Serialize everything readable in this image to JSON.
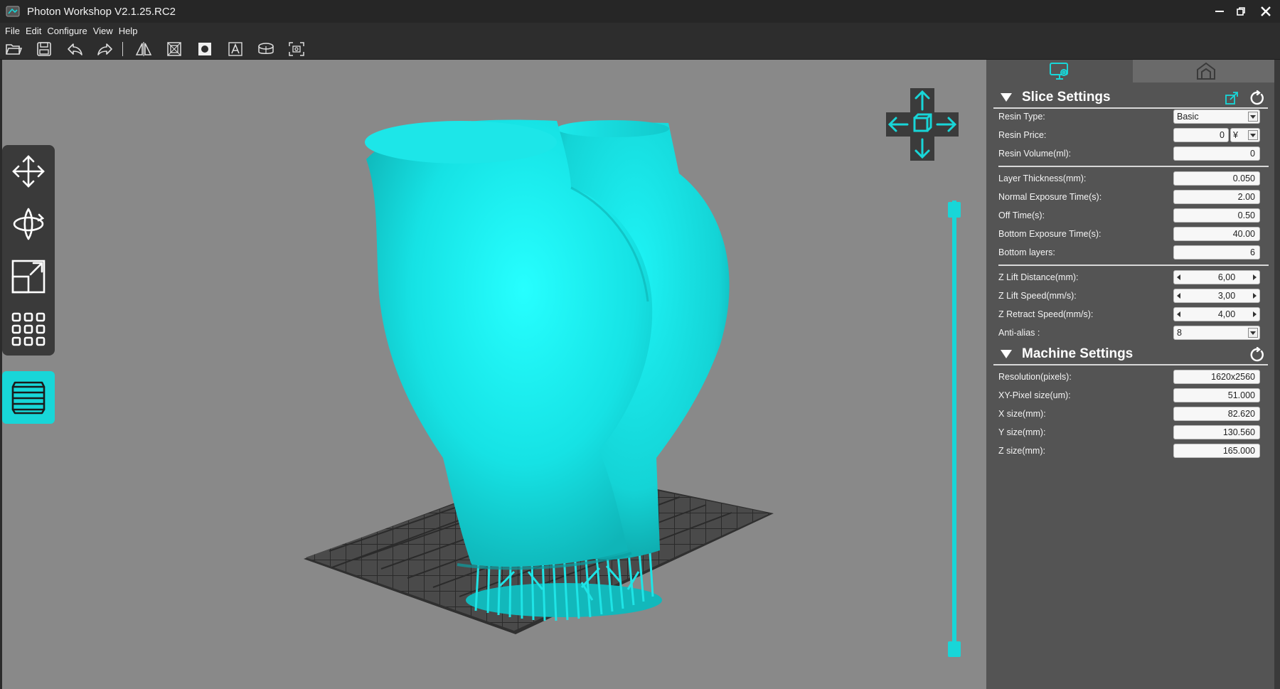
{
  "app": {
    "title": "Photon Workshop V2.1.25.RC2"
  },
  "menu": [
    "File",
    "Edit",
    "Configure",
    "View",
    "Help"
  ],
  "toolbar": [
    "open-folder-icon",
    "save-icon",
    "undo-icon",
    "redo-icon",
    "mirror-icon",
    "hollow-icon",
    "punch-hole-icon",
    "text-icon",
    "cylinder-icon",
    "screenshot-icon"
  ],
  "left_tools": [
    "move-icon",
    "rotate-icon",
    "scale-icon",
    "grid-arrange-icon",
    "layers-icon"
  ],
  "colors": {
    "accent": "#18d6d8",
    "model": "#16e0e3",
    "viewport_bg": "#898989",
    "panel_bg": "#545454"
  },
  "slice_settings": {
    "title": "Slice Settings",
    "resin_type": {
      "label": "Resin Type:",
      "value": "Basic"
    },
    "resin_price": {
      "label": "Resin Price:",
      "value": "0",
      "currency": "¥"
    },
    "resin_volume": {
      "label": "Resin Volume(ml):",
      "value": "0"
    },
    "layer_thickness": {
      "label": "Layer Thickness(mm):",
      "value": "0.050"
    },
    "normal_exposure": {
      "label": "Normal Exposure Time(s):",
      "value": "2.00"
    },
    "off_time": {
      "label": "Off Time(s):",
      "value": "0.50"
    },
    "bottom_exposure": {
      "label": "Bottom Exposure Time(s):",
      "value": "40.00"
    },
    "bottom_layers": {
      "label": "Bottom layers:",
      "value": "6"
    },
    "z_lift_distance": {
      "label": "Z Lift Distance(mm):",
      "value": "6,00"
    },
    "z_lift_speed": {
      "label": "Z Lift Speed(mm/s):",
      "value": "3,00"
    },
    "z_retract_speed": {
      "label": "Z Retract Speed(mm/s):",
      "value": "4,00"
    },
    "anti_alias": {
      "label": "Anti-alias :",
      "value": "8"
    }
  },
  "machine_settings": {
    "title": "Machine Settings",
    "resolution": {
      "label": "Resolution(pixels):",
      "value": "1620x2560"
    },
    "xy_pixel": {
      "label": "XY-Pixel size(um):",
      "value": "51.000"
    },
    "x_size": {
      "label": "X size(mm):",
      "value": "82.620"
    },
    "y_size": {
      "label": "Y size(mm):",
      "value": "130.560"
    },
    "z_size": {
      "label": "Z size(mm):",
      "value": "165.000"
    }
  }
}
